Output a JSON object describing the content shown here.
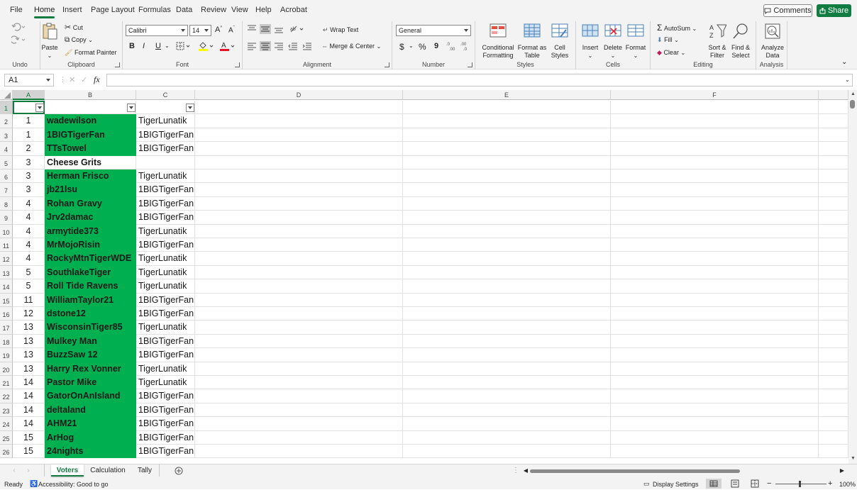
{
  "menu": {
    "tabs": [
      "File",
      "Home",
      "Insert",
      "Page Layout",
      "Formulas",
      "Data",
      "Review",
      "View",
      "Help",
      "Acrobat"
    ],
    "comments_label": "Comments",
    "share_label": "Share"
  },
  "ribbon": {
    "undo": {
      "group_label": "Undo"
    },
    "clipboard": {
      "paste": "Paste",
      "cut": "Cut",
      "copy": "Copy",
      "format_painter": "Format Painter",
      "group_label": "Clipboard"
    },
    "font": {
      "name": "Calibri",
      "size": "14",
      "bold": "B",
      "italic": "I",
      "underline": "U",
      "group_label": "Font"
    },
    "alignment": {
      "wrap_text": "Wrap Text",
      "merge_center": "Merge & Center",
      "group_label": "Alignment"
    },
    "number": {
      "format": "General",
      "currency": "$",
      "percent": "%",
      "comma": "9",
      "group_label": "Number"
    },
    "styles": {
      "conditional_1": "Conditional",
      "conditional_2": "Formatting",
      "table_1": "Format as",
      "table_2": "Table",
      "cell_1": "Cell",
      "cell_2": "Styles",
      "group_label": "Styles"
    },
    "cells": {
      "insert": "Insert",
      "delete": "Delete",
      "format": "Format",
      "group_label": "Cells"
    },
    "editing": {
      "autosum": "AutoSum",
      "fill": "Fill",
      "clear": "Clear",
      "sort_1": "Sort &",
      "sort_2": "Filter",
      "find_1": "Find &",
      "find_2": "Select",
      "group_label": "Editing"
    },
    "analysis": {
      "analyze_1": "Analyze",
      "analyze_2": "Data",
      "group_label": "Analysis"
    },
    "colors": {
      "accent": "#107c41",
      "fill_highlight": "#00b050",
      "font_color": "#e81123",
      "fill_color": "#ffff00"
    }
  },
  "formula_bar": {
    "name_box": "A1",
    "fx": "fx",
    "formula": ""
  },
  "columns": [
    "A",
    "B",
    "C",
    "D",
    "E",
    "F"
  ],
  "rows": [
    {
      "num": "1",
      "a": "",
      "b": "",
      "c": "",
      "green": false
    },
    {
      "num": "2",
      "a": "1",
      "b": "wadewilson",
      "c": "TigerLunatik",
      "green": true
    },
    {
      "num": "3",
      "a": "1",
      "b": "1BIGTigerFan",
      "c": "1BIGTigerFan",
      "green": true
    },
    {
      "num": "4",
      "a": "2",
      "b": "TTsTowel",
      "c": "1BIGTigerFan",
      "green": true
    },
    {
      "num": "5",
      "a": "3",
      "b": "Cheese Grits",
      "c": "",
      "green": false
    },
    {
      "num": "6",
      "a": "3",
      "b": "Herman Frisco",
      "c": "TigerLunatik",
      "green": true
    },
    {
      "num": "7",
      "a": "3",
      "b": "jb21lsu",
      "c": "1BIGTigerFan",
      "green": true
    },
    {
      "num": "8",
      "a": "4",
      "b": "Rohan Gravy",
      "c": "1BIGTigerFan",
      "green": true
    },
    {
      "num": "9",
      "a": "4",
      "b": "Jrv2damac",
      "c": "1BIGTigerFan",
      "green": true
    },
    {
      "num": "10",
      "a": "4",
      "b": "armytide373",
      "c": "TigerLunatik",
      "green": true
    },
    {
      "num": "11",
      "a": "4",
      "b": "MrMojoRisin",
      "c": "1BIGTigerFan",
      "green": true
    },
    {
      "num": "12",
      "a": "4",
      "b": "RockyMtnTigerWDE",
      "c": "TigerLunatik",
      "green": true
    },
    {
      "num": "13",
      "a": "5",
      "b": "SouthlakeTiger",
      "c": "TigerLunatik",
      "green": true
    },
    {
      "num": "14",
      "a": "5",
      "b": "Roll Tide Ravens",
      "c": "TigerLunatik",
      "green": true
    },
    {
      "num": "15",
      "a": "11",
      "b": "WilliamTaylor21",
      "c": "1BIGTigerFan",
      "green": true
    },
    {
      "num": "16",
      "a": "12",
      "b": "dstone12",
      "c": "1BIGTigerFan",
      "green": true
    },
    {
      "num": "17",
      "a": "13",
      "b": "WisconsinTiger85",
      "c": "TigerLunatik",
      "green": true
    },
    {
      "num": "18",
      "a": "13",
      "b": "Mulkey Man",
      "c": "1BIGTigerFan",
      "green": true
    },
    {
      "num": "19",
      "a": "13",
      "b": "BuzzSaw 12",
      "c": "1BIGTigerFan",
      "green": true
    },
    {
      "num": "20",
      "a": "13",
      "b": "Harry Rex Vonner",
      "c": "TigerLunatik",
      "green": true
    },
    {
      "num": "21",
      "a": "14",
      "b": "Pastor Mike",
      "c": "TigerLunatik",
      "green": true
    },
    {
      "num": "22",
      "a": "14",
      "b": "GatorOnAnIsland",
      "c": "1BIGTigerFan",
      "green": true
    },
    {
      "num": "23",
      "a": "14",
      "b": "deltaland",
      "c": "1BIGTigerFan",
      "green": true
    },
    {
      "num": "24",
      "a": "14",
      "b": "AHM21",
      "c": "1BIGTigerFan",
      "green": true
    },
    {
      "num": "25",
      "a": "15",
      "b": "ArHog",
      "c": "1BIGTigerFan",
      "green": true
    },
    {
      "num": "26",
      "a": "15",
      "b": "24nights",
      "c": "1BIGTigerFan",
      "green": true
    }
  ],
  "sheet_tabs": [
    "Voters",
    "Calculation",
    "Tally"
  ],
  "status": {
    "ready": "Ready",
    "accessibility": "Accessibility: Good to go",
    "display_settings": "Display Settings",
    "zoom": "100%"
  }
}
